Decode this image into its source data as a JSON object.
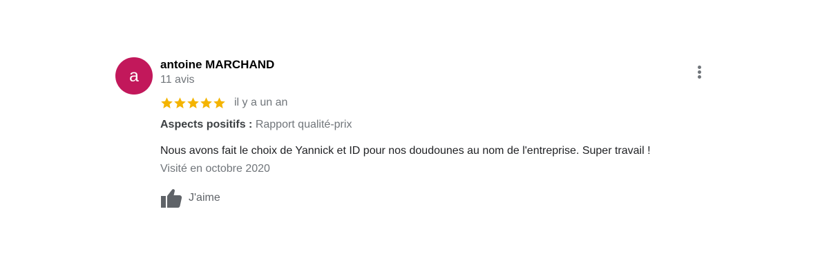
{
  "review": {
    "avatar_letter": "a",
    "avatar_color": "#c2185b",
    "author": "antoine MARCHAND",
    "review_count": "11 avis",
    "rating": 5,
    "rating_max": 5,
    "star_color": "#f4b400",
    "time": "il y a un an",
    "aspects_label": "Aspects positifs :",
    "aspects_value": "Rapport qualité-prix",
    "text": "Nous avons fait le choix de Yannick et ID pour nos doudounes au nom de l'entreprise. Super travail !",
    "visited": "Visité en octobre 2020",
    "like_label": "J'aime",
    "icons": {
      "menu": "more-vertical-icon",
      "star": "star-icon",
      "like": "thumbs-up-icon"
    }
  }
}
